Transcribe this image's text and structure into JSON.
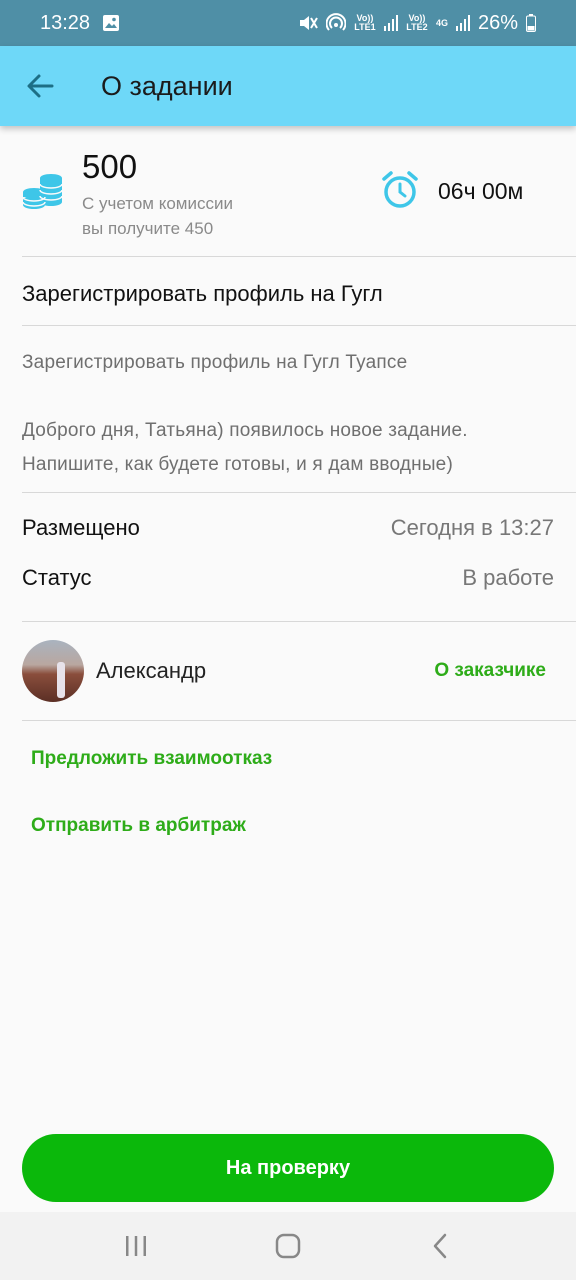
{
  "status_bar": {
    "time": "13:28",
    "volte1": "Vo)) LTE1",
    "volte2": "Vo)) LTE2",
    "network": "4G",
    "battery": "26%"
  },
  "app_bar": {
    "title": "О задании"
  },
  "task": {
    "price": "500",
    "commission_line1": "С учетом комиссии",
    "commission_line2": "вы получите 450",
    "time_left": "06ч 00м",
    "title": "Зарегистрировать профиль на Гугл",
    "description_line1": "Зарегистрировать профиль на Гугл Туапсе",
    "description_line2": "Доброго дня, Татьяна) появилось новое задание.",
    "description_line3": "Напишите, как будете готовы, и я дам вводные)"
  },
  "info": {
    "posted_label": "Размещено",
    "posted_value": "Сегодня в 13:27",
    "status_label": "Статус",
    "status_value": "В работе"
  },
  "owner": {
    "name": "Александр",
    "link": "О заказчике"
  },
  "actions": {
    "mutual_refusal": "Предложить взаимоотказ",
    "arbitration": "Отправить в арбитраж",
    "submit": "На проверку"
  },
  "colors": {
    "app_bar": "#6ed8f8",
    "accent_green": "#2eac19",
    "button_green": "#0bb80b",
    "icon_blue": "#3ec6e8"
  }
}
